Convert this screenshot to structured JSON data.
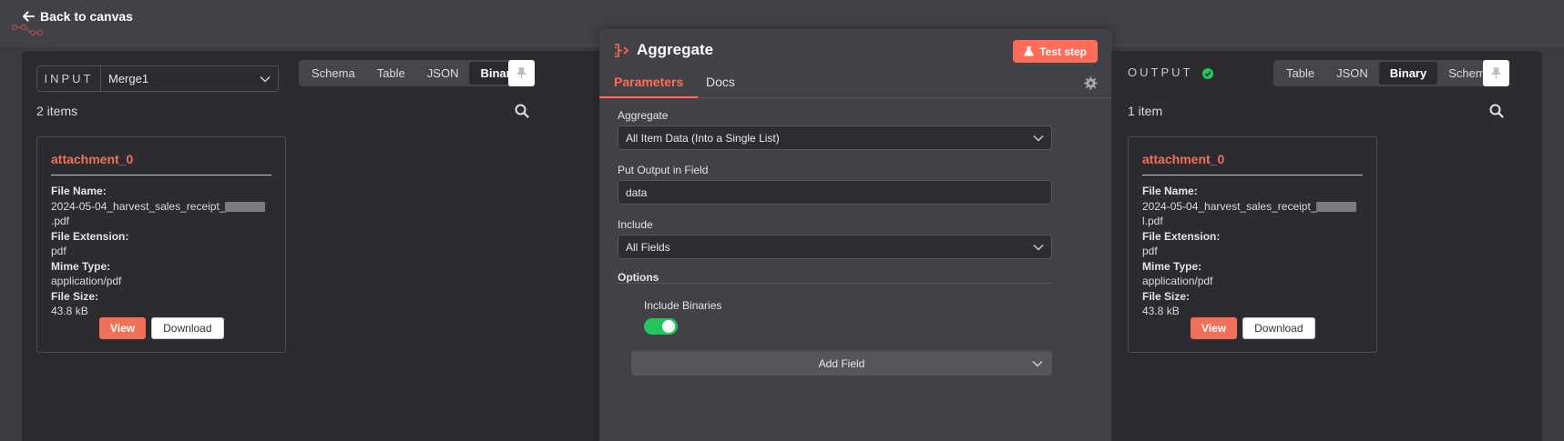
{
  "nav": {
    "back_label": "Back to canvas"
  },
  "input": {
    "label": "INPUT",
    "node_select": "Merge1",
    "tabs": [
      "Schema",
      "Table",
      "JSON",
      "Binary"
    ],
    "active_tab": "Binary",
    "items_count": "2 items",
    "card": {
      "title": "attachment_0",
      "file_name_label": "File Name:",
      "file_name_prefix": "2024-05-04_harvest_sales_receipt_",
      "file_name_suffix": ".pdf",
      "file_ext_label": "File Extension:",
      "file_ext": "pdf",
      "mime_label": "Mime Type:",
      "mime": "application/pdf",
      "size_label": "File Size:",
      "size": "43.8 kB",
      "view_label": "View",
      "download_label": "Download"
    }
  },
  "node": {
    "title": "Aggregate",
    "test_label": "Test step",
    "tabs": [
      "Parameters",
      "Docs"
    ],
    "params": {
      "aggregate_label": "Aggregate",
      "aggregate_value": "All Item Data (Into a Single List)",
      "output_field_label": "Put Output in Field",
      "output_field_value": "data",
      "include_label": "Include",
      "include_value": "All Fields",
      "options_label": "Options",
      "include_binaries_label": "Include Binaries",
      "include_binaries_on": true,
      "add_field_label": "Add Field"
    }
  },
  "output": {
    "label": "OUTPUT",
    "tabs": [
      "Table",
      "JSON",
      "Binary",
      "Schema"
    ],
    "active_tab": "Binary",
    "items_count": "1 item",
    "card": {
      "title": "attachment_0",
      "file_name_label": "File Name:",
      "file_name_prefix": "2024-05-04_harvest_sales_receipt_",
      "file_name_suffix": "l.pdf",
      "file_ext_label": "File Extension:",
      "file_ext": "pdf",
      "mime_label": "Mime Type:",
      "mime": "application/pdf",
      "size_label": "File Size:",
      "size": "43.8 kB",
      "view_label": "View",
      "download_label": "Download"
    }
  },
  "colors": {
    "accent": "#ff6d5a",
    "success": "#22c55e",
    "panel": "#2c2c30",
    "background": "#3a3a40"
  },
  "icons": [
    "arrow-left-icon",
    "chevron-down-icon",
    "pin-icon",
    "search-icon",
    "aggregate-icon",
    "flask-icon",
    "gear-icon",
    "check-circle-icon"
  ]
}
